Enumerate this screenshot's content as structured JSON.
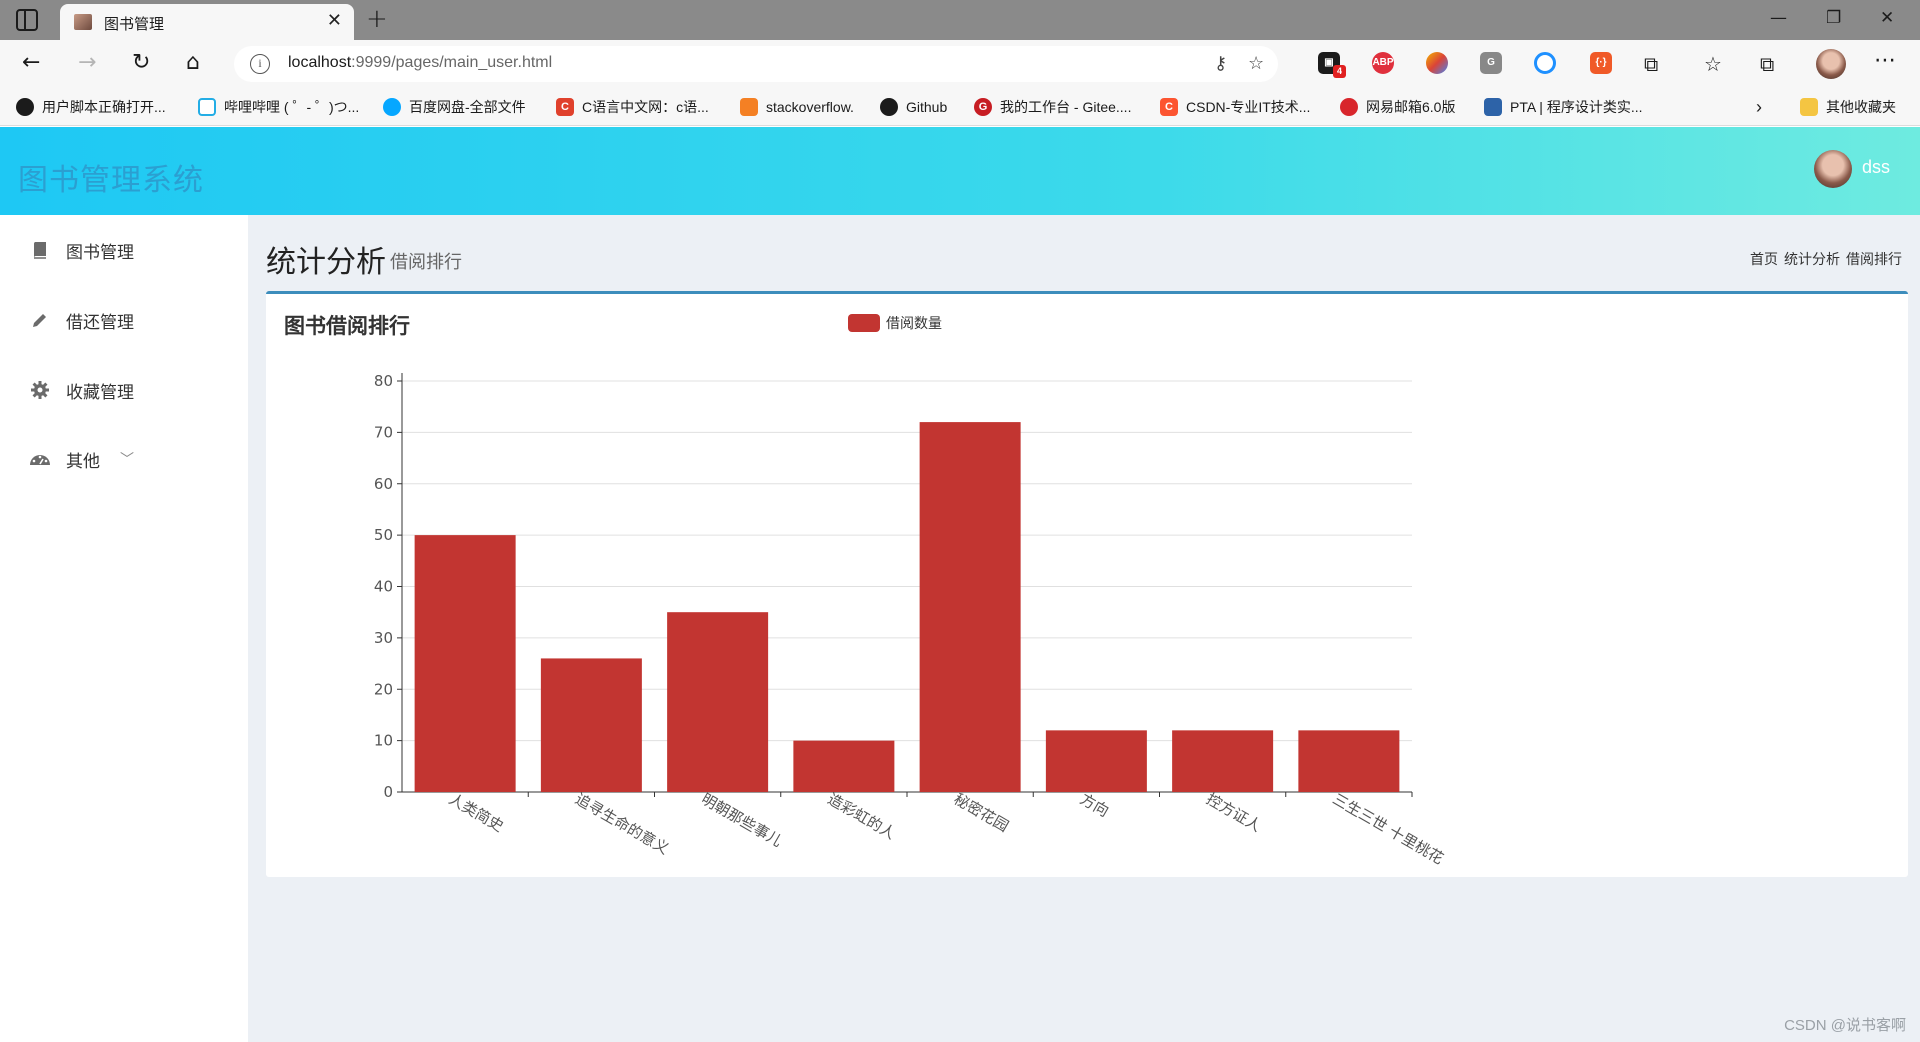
{
  "browser": {
    "tab_title": "图书管理",
    "url_host": "localhost",
    "url_rest": ":9999/pages/main_user.html",
    "ext_badge_count": "4",
    "bookmarks": [
      {
        "label": "用户脚本正确打开...",
        "icon_color": "#1b1b1b",
        "icon_text": ""
      },
      {
        "label": "哔哩哔哩 ( ゜- ゜)つ...",
        "icon_color": "#23ade5",
        "icon_text": ""
      },
      {
        "label": "百度网盘-全部文件",
        "icon_color": "#06a7ff",
        "icon_text": ""
      },
      {
        "label": "C语言中文网：c语...",
        "icon_color": "#e0412c",
        "icon_text": "C"
      },
      {
        "label": "stackoverflow.",
        "icon_color": "#f48024",
        "icon_text": ""
      },
      {
        "label": "Github",
        "icon_color": "#1b1b1b",
        "icon_text": ""
      },
      {
        "label": "我的工作台 - Gitee....",
        "icon_color": "#c71d23",
        "icon_text": "G"
      },
      {
        "label": "CSDN-专业IT技术...",
        "icon_color": "#fc5531",
        "icon_text": "C"
      },
      {
        "label": "网易邮箱6.0版",
        "icon_color": "#d8262c",
        "icon_text": ""
      },
      {
        "label": "PTA | 程序设计类实...",
        "icon_color": "#2d63a8",
        "icon_text": ""
      }
    ],
    "other_bookmarks": "其他收藏夹"
  },
  "app": {
    "title": "图书管理系统",
    "user_name": "dss"
  },
  "sidebar": {
    "items": [
      {
        "label": "图书管理",
        "icon": "book-icon"
      },
      {
        "label": "借还管理",
        "icon": "pencil-icon"
      },
      {
        "label": "收藏管理",
        "icon": "gear-icon"
      },
      {
        "label": "其他",
        "icon": "dashboard-icon"
      }
    ]
  },
  "page": {
    "title": "统计分析",
    "subtitle": "借阅排行",
    "breadcrumb": [
      "首页",
      "统计分析",
      "借阅排行"
    ]
  },
  "panel": {
    "title": "图书借阅排行"
  },
  "chart_data": {
    "type": "bar",
    "title": "图书借阅排行",
    "legend": [
      "借阅数量"
    ],
    "legend_position": "top-center",
    "series": [
      {
        "name": "借阅数量",
        "color": "#c23531",
        "values": [
          50,
          26,
          35,
          10,
          72,
          12,
          12,
          12
        ]
      }
    ],
    "categories": [
      "人类简史",
      "追寻生命的意义",
      "明朝那些事儿",
      "造彩虹的人",
      "秘密花园",
      "方向",
      "控方证人",
      "三生三世 十里桃花"
    ],
    "y_ticks": [
      "0",
      "10",
      "20",
      "30",
      "40",
      "50",
      "60",
      "70",
      "80"
    ],
    "ylim": [
      0,
      80
    ],
    "grid": true
  },
  "watermark": "CSDN @说书客啊"
}
